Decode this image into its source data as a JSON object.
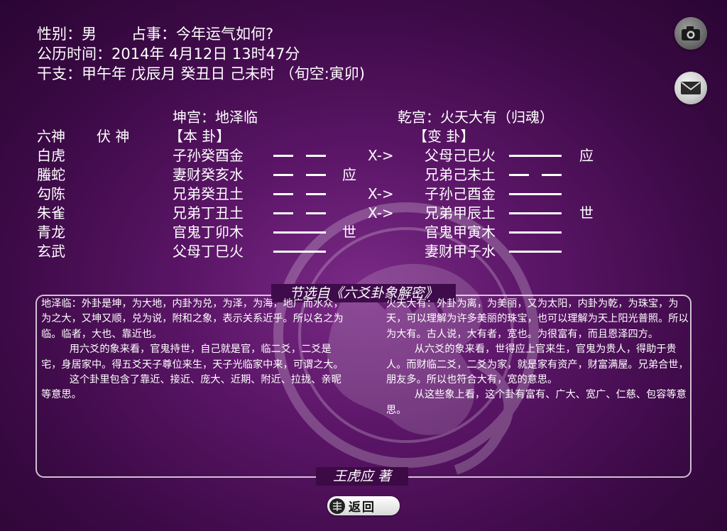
{
  "header": {
    "gender_label": "性别：男",
    "question": "占事：今年运气如何?",
    "date_line": "公历时间：2014年 4月12日 13时47分",
    "ganzhi_line": "干支：甲午年 戊辰月 癸丑日 己未时 （旬空:寅卯)"
  },
  "gua": {
    "ben_palace": "坤宫：地泽临",
    "bian_palace": "乾宫：火天大有（归魂）",
    "col_liushen": "六神",
    "col_fushen": "伏  神",
    "col_ben": "【本      卦】",
    "col_bian": "【变      卦】",
    "rows": [
      {
        "shen": "白虎",
        "ben": "子孙癸酉金",
        "ben_yao": "yin",
        "ben_mark": "",
        "move": "X->",
        "bian": "父母己巳火",
        "bian_yao": "yang",
        "bian_mark": "应"
      },
      {
        "shen": "螣蛇",
        "ben": "妻财癸亥水",
        "ben_yao": "yin",
        "ben_mark": "应",
        "move": "",
        "bian": "兄弟己未土",
        "bian_yao": "yin",
        "bian_mark": ""
      },
      {
        "shen": "勾陈",
        "ben": "兄弟癸丑土",
        "ben_yao": "yin",
        "ben_mark": "",
        "move": "X->",
        "bian": "子孙己酉金",
        "bian_yao": "yang",
        "bian_mark": ""
      },
      {
        "shen": "朱雀",
        "ben": "兄弟丁丑土",
        "ben_yao": "yin",
        "ben_mark": "",
        "move": "X->",
        "bian": "兄弟甲辰土",
        "bian_yao": "yang",
        "bian_mark": "世"
      },
      {
        "shen": "青龙",
        "ben": "官鬼丁卯木",
        "ben_yao": "yang",
        "ben_mark": "世",
        "move": "",
        "bian": "官鬼甲寅木",
        "bian_yao": "yang",
        "bian_mark": ""
      },
      {
        "shen": "玄武",
        "ben": "父母丁巳火",
        "ben_yao": "yang",
        "ben_mark": "",
        "move": "",
        "bian": "妻财甲子水",
        "bian_yao": "yang",
        "bian_mark": ""
      }
    ]
  },
  "panel": {
    "title": "节选自《六爻卦象解密》",
    "left_paragraphs": [
      "地泽临：外卦是坤，为大地，内卦为兑，为泽，为海，地广而水众，为之大，又坤又顺，兑为说，附和之象，表示关系近乎。所以名之为临。临者，大也、靠近也。",
      "用六爻的象来看，官鬼持世，自己就是官，临二爻，二爻是宅，身居家中。得五爻天子尊位来生，天子光临家中来，可谓之大。",
      "这个卦里包含了靠近、接近、庞大、近期、附近、拉拢、亲昵等意思。"
    ],
    "right_paragraphs": [
      "火天大有：外卦为离，为美丽，又为太阳，内卦为乾，为珠宝，为天，可以理解为许多美丽的珠宝，也可以理解为天上阳光普照。所以为大有。古人说，大有者，宽也。为很富有，而且恩泽四方。",
      "从六爻的象来看，世得应上官来生，官鬼为贵人，得助于贵人。而财临二爻，二爻为家，就是家有资产，财富满屋。兄弟合世，朋友多。所以也符合大有，宽的意思。",
      "从这些象上看，这个卦有富有、广大、宽广、仁慈、包容等意思。"
    ],
    "author": "王虎应 著"
  },
  "buttons": {
    "back_label": "返回",
    "camera_icon": "camera-icon",
    "mail_icon": "mail-icon"
  }
}
